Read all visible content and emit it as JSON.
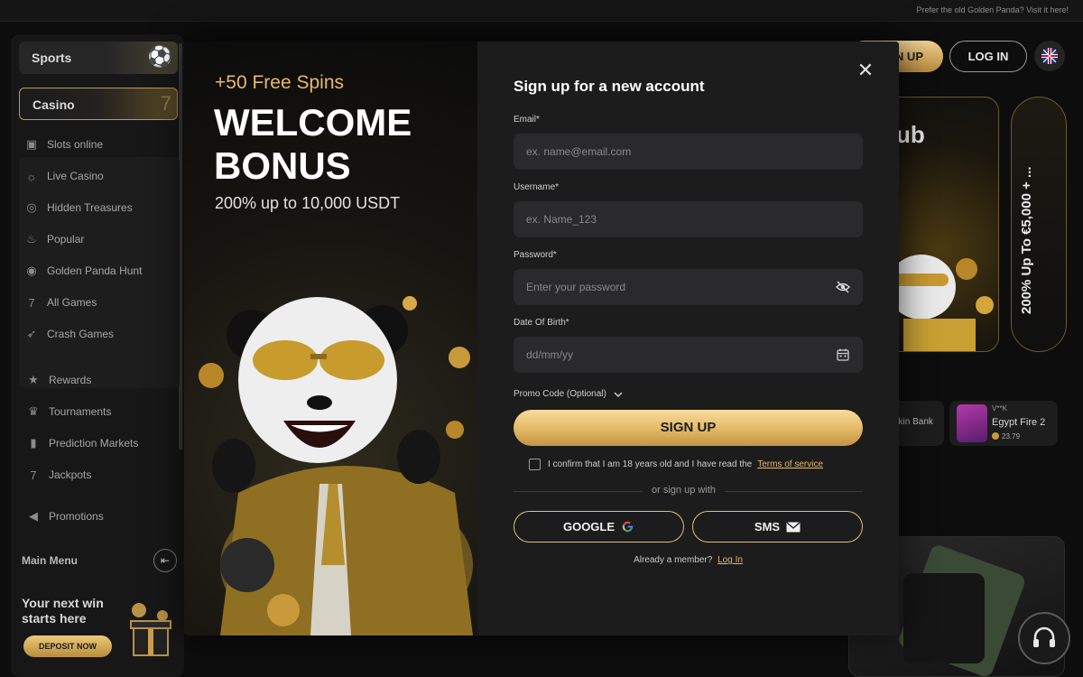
{
  "topbar": {
    "old_site_link": "Prefer the old Golden Panda? Visit it here!"
  },
  "header": {
    "signup_label": "SIGN UP",
    "login_label": "LOG IN"
  },
  "sidebar": {
    "tabs": [
      {
        "label": "Sports",
        "active": false
      },
      {
        "label": "Casino",
        "active": true
      }
    ],
    "casino_items": [
      {
        "label": "Slots online",
        "icon": "slot-machine-icon"
      },
      {
        "label": "Live Casino",
        "icon": "live-icon"
      },
      {
        "label": "Hidden Treasures",
        "icon": "treasure-icon"
      },
      {
        "label": "Popular",
        "icon": "flame-icon"
      },
      {
        "label": "Golden Panda Hunt",
        "icon": "panda-icon"
      },
      {
        "label": "All Games",
        "icon": "seven-icon"
      },
      {
        "label": "Crash Games",
        "icon": "rocket-icon"
      }
    ],
    "extra_items": [
      {
        "label": "Rewards",
        "icon": "star-icon"
      },
      {
        "label": "Tournaments",
        "icon": "trophy-icon"
      },
      {
        "label": "Prediction Markets",
        "icon": "bar-chart-icon"
      },
      {
        "label": "Jackpots",
        "icon": "seven-icon"
      },
      {
        "label": "Promotions",
        "icon": "megaphone-icon"
      }
    ],
    "main_menu_label": "Main Menu",
    "promo_line1": "Your next win",
    "promo_line2": "starts here",
    "deposit_label": "DEPOSIT NOW"
  },
  "background": {
    "banner_word": "ub",
    "banner_vertical": "200% Up To €5,000 + ...",
    "game_1_name": "okin Bank",
    "game_2_top": "V**K",
    "game_2_name": "Egypt Fire 2",
    "game_2_value": "23.79"
  },
  "modal": {
    "promo": {
      "spins": "+50 Free Spins",
      "title_line1": "WELCOME",
      "title_line2": "BONUS",
      "subtitle": "200% up to 10,000 USDT"
    },
    "form": {
      "title": "Sign up for a new account",
      "email_label": "Email*",
      "email_placeholder": "ex. name@email.com",
      "username_label": "Username*",
      "username_placeholder": "ex. Name_123",
      "password_label": "Password*",
      "password_placeholder": "Enter your password",
      "dob_label": "Date Of Birth*",
      "dob_placeholder": "dd/mm/yy",
      "promo_code_label": "Promo Code (Optional)",
      "signup_label": "SIGN UP",
      "confirm_text": "I confirm that I am 18 years old and I have read the",
      "terms_link": "Terms of service",
      "or_text": "or sign up with",
      "google_label": "GOOGLE",
      "sms_label": "SMS",
      "member_text": "Already a member?",
      "login_link": "Log In"
    }
  },
  "colors": {
    "accent_gold": "#e8b969",
    "button_gold": "#e3b865",
    "modal_bg": "#1c1c1d",
    "input_bg": "#2a2a2c",
    "page_bg": "#0d0d0e"
  }
}
